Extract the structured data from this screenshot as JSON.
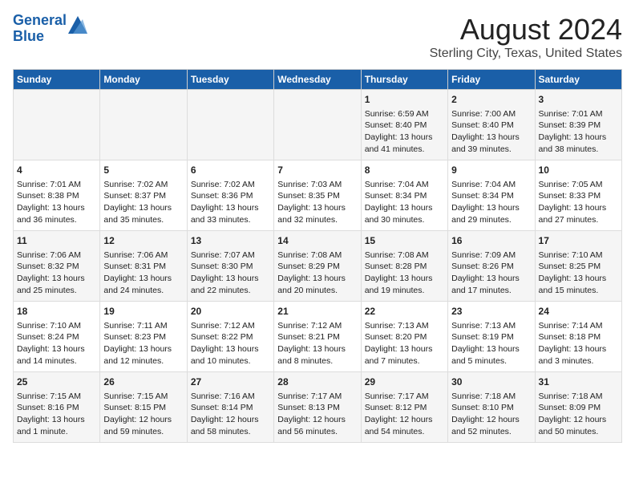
{
  "header": {
    "logo_line1": "General",
    "logo_line2": "Blue",
    "title": "August 2024",
    "subtitle": "Sterling City, Texas, United States"
  },
  "days_of_week": [
    "Sunday",
    "Monday",
    "Tuesday",
    "Wednesday",
    "Thursday",
    "Friday",
    "Saturday"
  ],
  "weeks": [
    [
      {
        "day": "",
        "content": ""
      },
      {
        "day": "",
        "content": ""
      },
      {
        "day": "",
        "content": ""
      },
      {
        "day": "",
        "content": ""
      },
      {
        "day": "1",
        "content": "Sunrise: 6:59 AM\nSunset: 8:40 PM\nDaylight: 13 hours\nand 41 minutes."
      },
      {
        "day": "2",
        "content": "Sunrise: 7:00 AM\nSunset: 8:40 PM\nDaylight: 13 hours\nand 39 minutes."
      },
      {
        "day": "3",
        "content": "Sunrise: 7:01 AM\nSunset: 8:39 PM\nDaylight: 13 hours\nand 38 minutes."
      }
    ],
    [
      {
        "day": "4",
        "content": "Sunrise: 7:01 AM\nSunset: 8:38 PM\nDaylight: 13 hours\nand 36 minutes."
      },
      {
        "day": "5",
        "content": "Sunrise: 7:02 AM\nSunset: 8:37 PM\nDaylight: 13 hours\nand 35 minutes."
      },
      {
        "day": "6",
        "content": "Sunrise: 7:02 AM\nSunset: 8:36 PM\nDaylight: 13 hours\nand 33 minutes."
      },
      {
        "day": "7",
        "content": "Sunrise: 7:03 AM\nSunset: 8:35 PM\nDaylight: 13 hours\nand 32 minutes."
      },
      {
        "day": "8",
        "content": "Sunrise: 7:04 AM\nSunset: 8:34 PM\nDaylight: 13 hours\nand 30 minutes."
      },
      {
        "day": "9",
        "content": "Sunrise: 7:04 AM\nSunset: 8:34 PM\nDaylight: 13 hours\nand 29 minutes."
      },
      {
        "day": "10",
        "content": "Sunrise: 7:05 AM\nSunset: 8:33 PM\nDaylight: 13 hours\nand 27 minutes."
      }
    ],
    [
      {
        "day": "11",
        "content": "Sunrise: 7:06 AM\nSunset: 8:32 PM\nDaylight: 13 hours\nand 25 minutes."
      },
      {
        "day": "12",
        "content": "Sunrise: 7:06 AM\nSunset: 8:31 PM\nDaylight: 13 hours\nand 24 minutes."
      },
      {
        "day": "13",
        "content": "Sunrise: 7:07 AM\nSunset: 8:30 PM\nDaylight: 13 hours\nand 22 minutes."
      },
      {
        "day": "14",
        "content": "Sunrise: 7:08 AM\nSunset: 8:29 PM\nDaylight: 13 hours\nand 20 minutes."
      },
      {
        "day": "15",
        "content": "Sunrise: 7:08 AM\nSunset: 8:28 PM\nDaylight: 13 hours\nand 19 minutes."
      },
      {
        "day": "16",
        "content": "Sunrise: 7:09 AM\nSunset: 8:26 PM\nDaylight: 13 hours\nand 17 minutes."
      },
      {
        "day": "17",
        "content": "Sunrise: 7:10 AM\nSunset: 8:25 PM\nDaylight: 13 hours\nand 15 minutes."
      }
    ],
    [
      {
        "day": "18",
        "content": "Sunrise: 7:10 AM\nSunset: 8:24 PM\nDaylight: 13 hours\nand 14 minutes."
      },
      {
        "day": "19",
        "content": "Sunrise: 7:11 AM\nSunset: 8:23 PM\nDaylight: 13 hours\nand 12 minutes."
      },
      {
        "day": "20",
        "content": "Sunrise: 7:12 AM\nSunset: 8:22 PM\nDaylight: 13 hours\nand 10 minutes."
      },
      {
        "day": "21",
        "content": "Sunrise: 7:12 AM\nSunset: 8:21 PM\nDaylight: 13 hours\nand 8 minutes."
      },
      {
        "day": "22",
        "content": "Sunrise: 7:13 AM\nSunset: 8:20 PM\nDaylight: 13 hours\nand 7 minutes."
      },
      {
        "day": "23",
        "content": "Sunrise: 7:13 AM\nSunset: 8:19 PM\nDaylight: 13 hours\nand 5 minutes."
      },
      {
        "day": "24",
        "content": "Sunrise: 7:14 AM\nSunset: 8:18 PM\nDaylight: 13 hours\nand 3 minutes."
      }
    ],
    [
      {
        "day": "25",
        "content": "Sunrise: 7:15 AM\nSunset: 8:16 PM\nDaylight: 13 hours\nand 1 minute."
      },
      {
        "day": "26",
        "content": "Sunrise: 7:15 AM\nSunset: 8:15 PM\nDaylight: 12 hours\nand 59 minutes."
      },
      {
        "day": "27",
        "content": "Sunrise: 7:16 AM\nSunset: 8:14 PM\nDaylight: 12 hours\nand 58 minutes."
      },
      {
        "day": "28",
        "content": "Sunrise: 7:17 AM\nSunset: 8:13 PM\nDaylight: 12 hours\nand 56 minutes."
      },
      {
        "day": "29",
        "content": "Sunrise: 7:17 AM\nSunset: 8:12 PM\nDaylight: 12 hours\nand 54 minutes."
      },
      {
        "day": "30",
        "content": "Sunrise: 7:18 AM\nSunset: 8:10 PM\nDaylight: 12 hours\nand 52 minutes."
      },
      {
        "day": "31",
        "content": "Sunrise: 7:18 AM\nSunset: 8:09 PM\nDaylight: 12 hours\nand 50 minutes."
      }
    ]
  ]
}
